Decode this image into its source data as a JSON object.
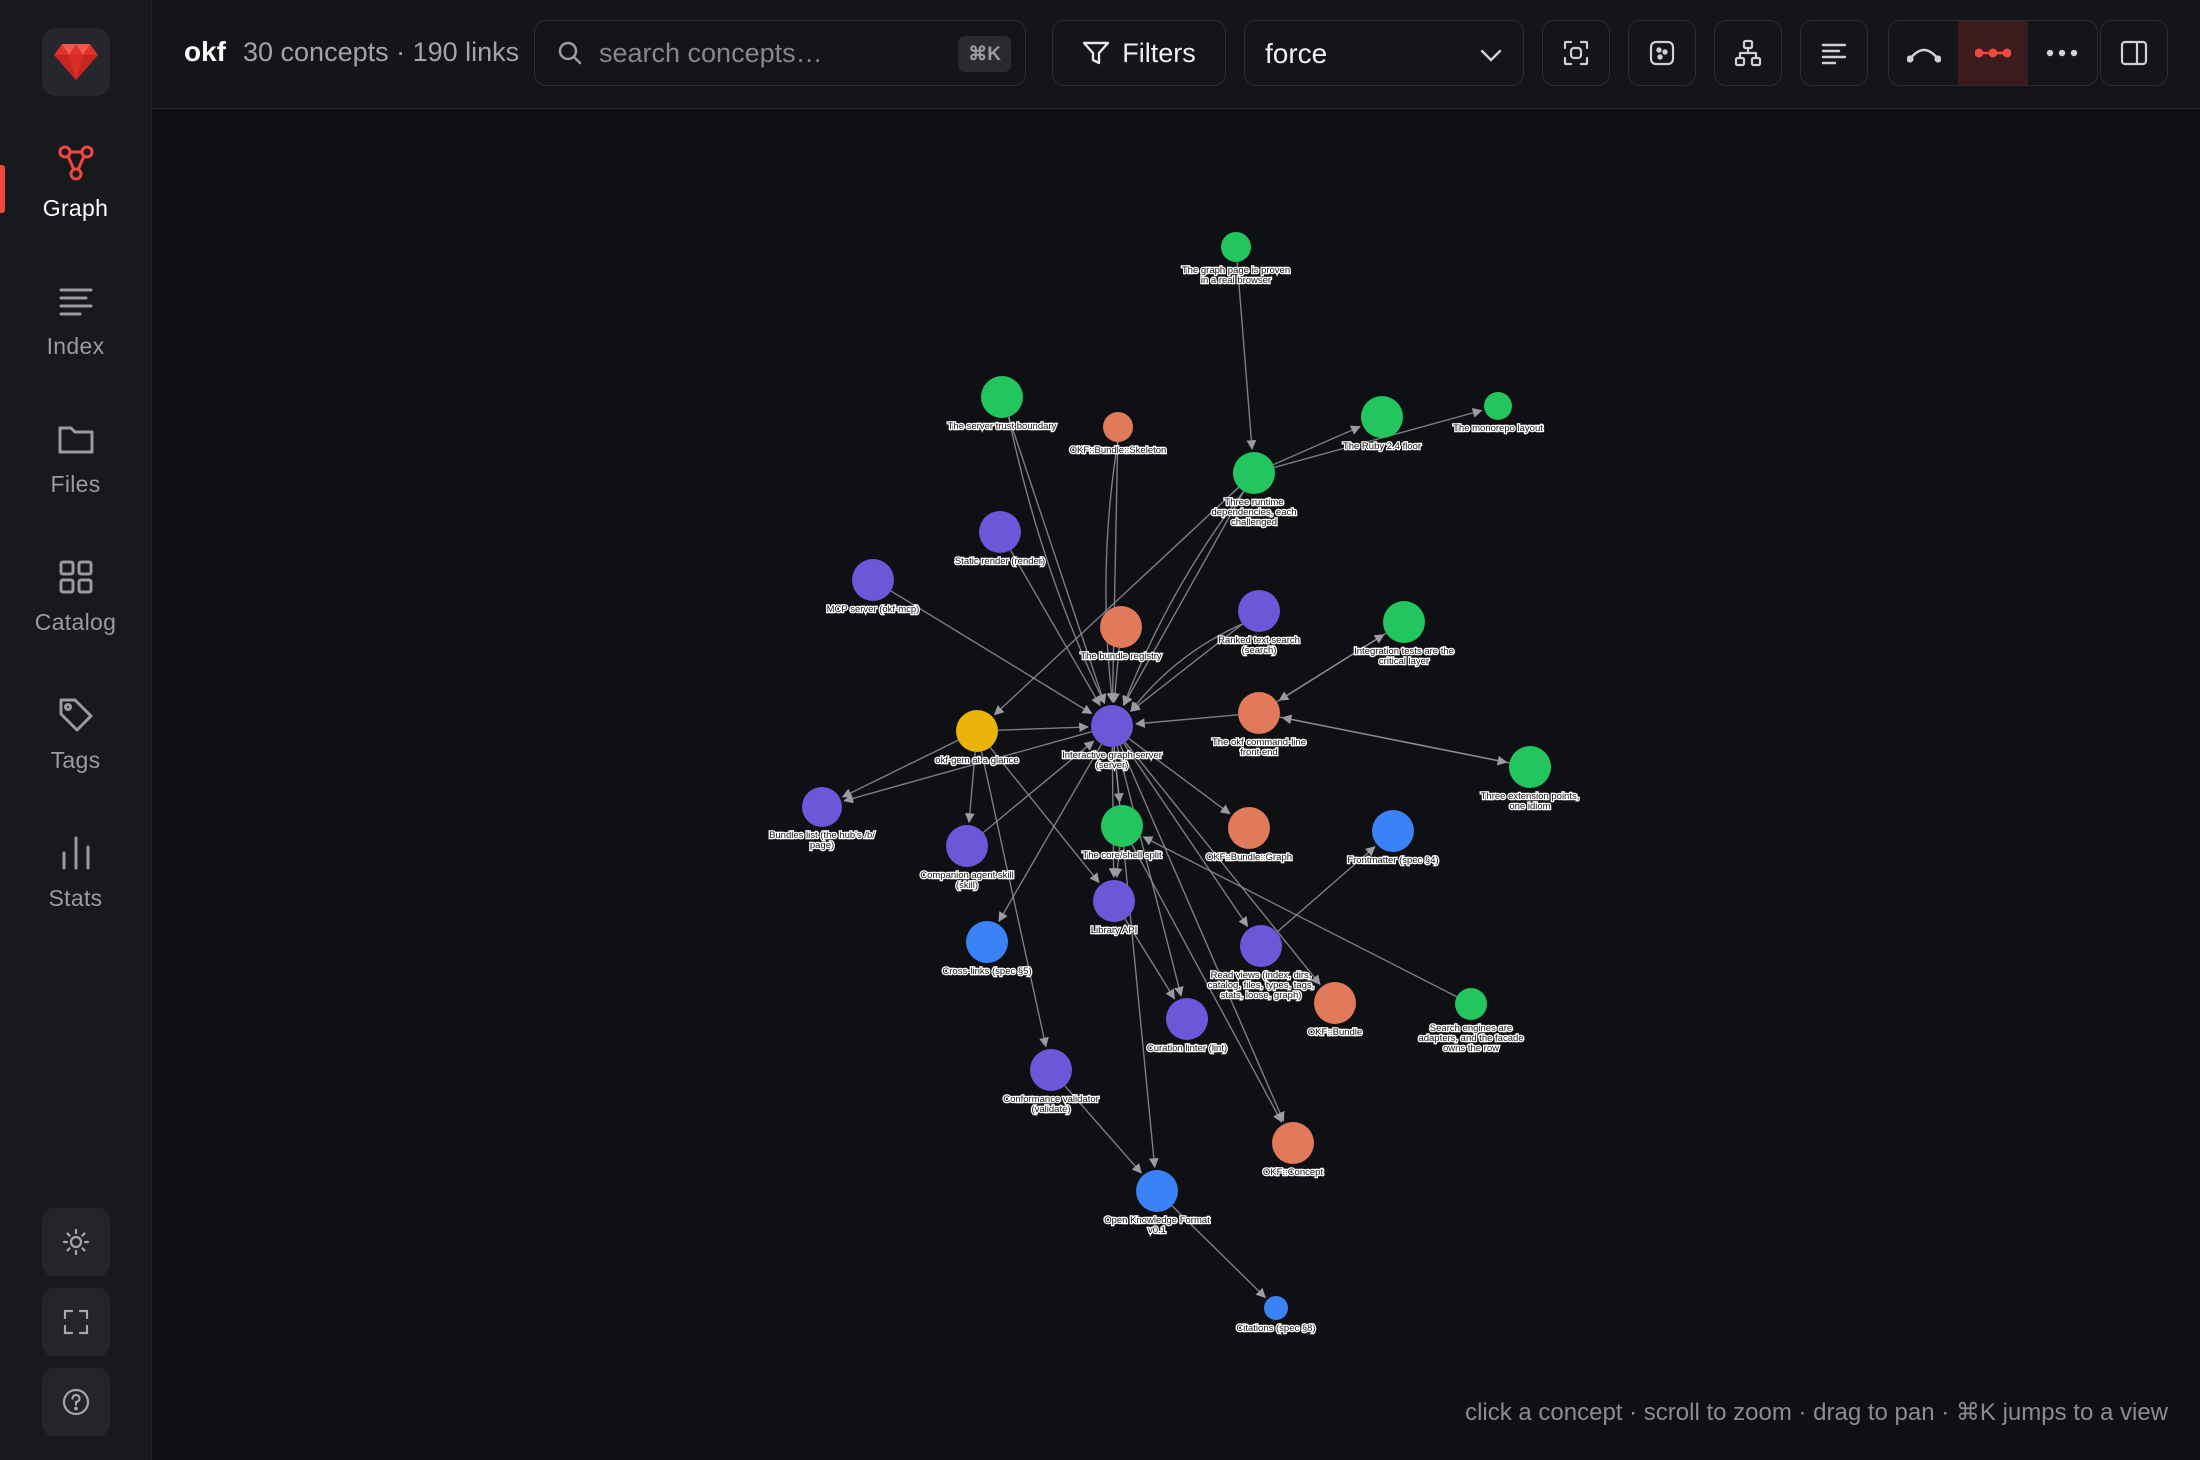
{
  "app": {
    "name": "okf",
    "counts": "30 concepts · 190 links"
  },
  "search": {
    "placeholder": "search concepts…",
    "shortcut": "⌘K"
  },
  "toolbar": {
    "filters_label": "Filters",
    "layout_value": "force",
    "icons": [
      "fit-view-icon",
      "dots-icon",
      "hierarchy-icon",
      "align-left-icon",
      "curved-edge-icon",
      "straight-edge-icon",
      "more-icon",
      "sidebar-toggle-icon"
    ],
    "active_edge_mode": "straight"
  },
  "sidebar": {
    "items": [
      {
        "label": "Graph",
        "icon": "graph-icon",
        "active": true
      },
      {
        "label": "Index",
        "icon": "list-icon",
        "active": false
      },
      {
        "label": "Files",
        "icon": "folder-icon",
        "active": false
      },
      {
        "label": "Catalog",
        "icon": "grid-icon",
        "active": false
      },
      {
        "label": "Tags",
        "icon": "tag-icon",
        "active": false
      },
      {
        "label": "Stats",
        "icon": "bar-chart-icon",
        "active": false
      }
    ],
    "bottom": [
      "theme-toggle-icon",
      "fullscreen-icon",
      "help-icon"
    ]
  },
  "colors": {
    "accent": "#f0483e",
    "green": "#22c55e",
    "orange": "#e07a5a",
    "purple": "#6e56d8",
    "blue": "#3b82f6",
    "yellow": "#eab308",
    "edge": "#8f9099"
  },
  "graph": {
    "nodes": [
      {
        "id": "graph-page",
        "label": [
          "The graph page is proven",
          "in a real browser"
        ],
        "color": "green"
      },
      {
        "id": "trust",
        "label": [
          "The server trust boundary"
        ],
        "color": "green"
      },
      {
        "id": "skeleton",
        "label": [
          "OKF::Bundle::Skeleton"
        ],
        "color": "orange"
      },
      {
        "id": "ruby",
        "label": [
          "The Ruby 2.4 floor"
        ],
        "color": "green"
      },
      {
        "id": "monorepo",
        "label": [
          "The monorepo layout"
        ],
        "color": "green"
      },
      {
        "id": "runtime",
        "label": [
          "Three runtime",
          "dependencies, each",
          "challenged"
        ],
        "color": "green"
      },
      {
        "id": "static",
        "label": [
          "Static render (render)"
        ],
        "color": "purple"
      },
      {
        "id": "mcp",
        "label": [
          "MCP server (okf-mcp)"
        ],
        "color": "purple"
      },
      {
        "id": "registry",
        "label": [
          "The bundle registry"
        ],
        "color": "orange"
      },
      {
        "id": "ranked",
        "label": [
          "Ranked text search",
          "(search)"
        ],
        "color": "purple"
      },
      {
        "id": "integration",
        "label": [
          "Integration tests are the",
          "critical layer"
        ],
        "color": "green"
      },
      {
        "id": "glance",
        "label": [
          "okf-gem at a glance"
        ],
        "color": "yellow"
      },
      {
        "id": "server",
        "label": [
          "Interactive graph server",
          "(server)"
        ],
        "color": "purple"
      },
      {
        "id": "cli",
        "label": [
          "The okf command-line",
          "front end"
        ],
        "color": "orange"
      },
      {
        "id": "extension",
        "label": [
          "Three extension points,",
          "one idiom"
        ],
        "color": "green"
      },
      {
        "id": "bundles-list",
        "label": [
          "Bundles list (the hub's /b/",
          "page)"
        ],
        "color": "purple"
      },
      {
        "id": "companion",
        "label": [
          "Companion agent skill",
          "(skill)"
        ],
        "color": "purple"
      },
      {
        "id": "core",
        "label": [
          "The core/shell split"
        ],
        "color": "green"
      },
      {
        "id": "bgraph",
        "label": [
          "OKF::Bundle::Graph"
        ],
        "color": "orange"
      },
      {
        "id": "frontmatter",
        "label": [
          "Frontmatter (spec §4)"
        ],
        "color": "blue"
      },
      {
        "id": "library",
        "label": [
          "Library API"
        ],
        "color": "purple"
      },
      {
        "id": "crosslinks",
        "label": [
          "Cross-links (spec §5)"
        ],
        "color": "blue"
      },
      {
        "id": "readviews",
        "label": [
          "Read views (index, dirs,",
          "catalog, files, types, tags,",
          "stats, loose, graph)"
        ],
        "color": "purple"
      },
      {
        "id": "bundle",
        "label": [
          "OKF::Bundle"
        ],
        "color": "orange"
      },
      {
        "id": "search-engines",
        "label": [
          "Search engines are",
          "adapters, and the facade",
          "owns the row"
        ],
        "color": "green"
      },
      {
        "id": "curation",
        "label": [
          "Curation linter (lint)"
        ],
        "color": "purple"
      },
      {
        "id": "conformance",
        "label": [
          "Conformance validator",
          "(validate)"
        ],
        "color": "purple"
      },
      {
        "id": "concept",
        "label": [
          "OKF::Concept"
        ],
        "color": "orange"
      },
      {
        "id": "okf-format",
        "label": [
          "Open Knowledge Format",
          "v0.1"
        ],
        "color": "blue"
      },
      {
        "id": "citations",
        "label": [
          "Citations (spec §8)"
        ],
        "color": "blue"
      }
    ],
    "edges": [
      [
        "graph-page",
        "runtime"
      ],
      [
        "runtime",
        "ruby"
      ],
      [
        "runtime",
        "monorepo"
      ],
      [
        "trust",
        "server"
      ],
      [
        "trust",
        "server"
      ],
      [
        "skeleton",
        "server"
      ],
      [
        "skeleton",
        "server"
      ],
      [
        "runtime",
        "server"
      ],
      [
        "runtime",
        "server"
      ],
      [
        "runtime",
        "glance"
      ],
      [
        "static",
        "server"
      ],
      [
        "mcp",
        "server"
      ],
      [
        "registry",
        "server"
      ],
      [
        "ranked",
        "server"
      ],
      [
        "ranked",
        "server"
      ],
      [
        "integration",
        "cli"
      ],
      [
        "cli",
        "integration"
      ],
      [
        "cli",
        "server"
      ],
      [
        "extension",
        "cli"
      ],
      [
        "cli",
        "extension"
      ],
      [
        "glance",
        "server"
      ],
      [
        "glance",
        "bundles-list"
      ],
      [
        "server",
        "bundles-list"
      ],
      [
        "glance",
        "companion"
      ],
      [
        "glance",
        "conformance"
      ],
      [
        "glance",
        "library"
      ],
      [
        "server",
        "core"
      ],
      [
        "server",
        "bgraph"
      ],
      [
        "server",
        "library"
      ],
      [
        "server",
        "crosslinks"
      ],
      [
        "server",
        "readviews"
      ],
      [
        "server",
        "bundle"
      ],
      [
        "server",
        "concept"
      ],
      [
        "server",
        "curation"
      ],
      [
        "server",
        "okf-format"
      ],
      [
        "core",
        "library"
      ],
      [
        "readviews",
        "frontmatter"
      ],
      [
        "search-engines",
        "core"
      ],
      [
        "library",
        "curation"
      ],
      [
        "conformance",
        "okf-format"
      ],
      [
        "okf-format",
        "citations"
      ],
      [
        "core",
        "concept"
      ],
      [
        "companion",
        "server"
      ]
    ]
  },
  "hint": "click a concept · scroll to zoom · drag to pan · ⌘K jumps to a view"
}
